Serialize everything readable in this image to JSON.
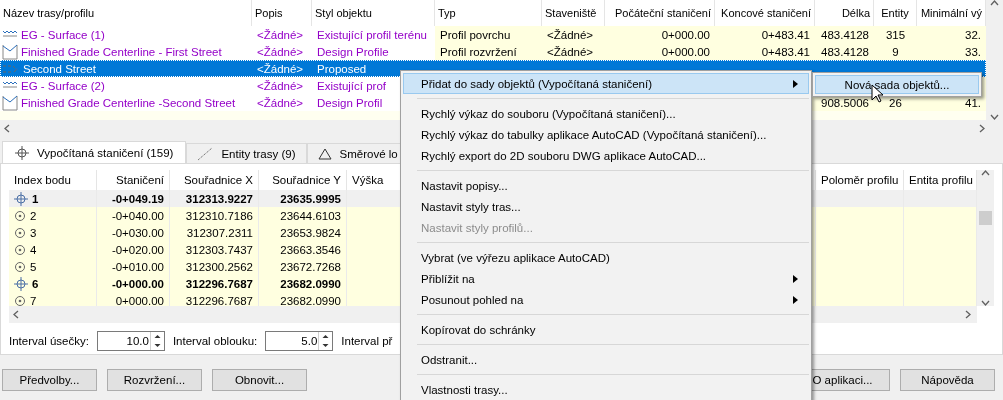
{
  "top_table": {
    "columns": [
      "Název trasy/profilu",
      "Popis",
      "Styl objektu",
      "Typ",
      "Staveniště",
      "Počáteční staničení",
      "Koncové staničení",
      "Délka",
      "Entity",
      "Minimální vý"
    ],
    "rows": [
      {
        "children": [
          {
            "kind": "surface-profile",
            "selected": false,
            "cells": [
              "EG - Surface (1)",
              "<Žádné>",
              "Existující profil terénu",
              "Profil povrchu",
              "<Žádné>",
              "0+000.00",
              "0+483.41",
              "483.4128",
              "315",
              "32."
            ]
          },
          {
            "kind": "design-profile",
            "selected": false,
            "cells": [
              "Finished Grade Centerline - First Street",
              "<Žádné>",
              "Design Profile",
              "Profil rozvržení",
              "<Žádné>",
              "0+000.00",
              "0+483.41",
              "483.4128",
              "9",
              "33."
            ]
          }
        ]
      },
      {
        "kind": "alignment",
        "selected": true,
        "cells": [
          "Second Street",
          "<Žádné>",
          "Proposed"
        ],
        "children": [
          {
            "kind": "surface-profile",
            "selected": false,
            "cells": [
              "EG - Surface (2)",
              "<Žádné>",
              "Existující prof"
            ]
          },
          {
            "kind": "design-profile",
            "selected": false,
            "cells": [
              "Finished Grade Centerline -Second Street",
              "<Žádné>",
              "Design Profil",
              null,
              null,
              null,
              null,
              "908.5006",
              "26",
              "41."
            ]
          }
        ]
      }
    ]
  },
  "tabs": [
    {
      "label": "Vypočítaná staničení (159)",
      "selected": true
    },
    {
      "label": "Entity trasy (9)",
      "selected": false
    },
    {
      "label": "Směrové lo",
      "selected": false
    }
  ],
  "points_table": {
    "columns": [
      "Index bodu",
      "Staničení",
      "Souřadnice X",
      "Souřadnice Y",
      "Výška",
      "Poloměr profilu",
      "Entita profilu"
    ],
    "rows": [
      {
        "kind": "pi",
        "selected": true,
        "cells": [
          "1",
          "-0+049.19",
          "312313.9227",
          "23635.9995"
        ]
      },
      {
        "kind": "point",
        "selected": false,
        "cells": [
          "2",
          "-0+040.00",
          "312310.7186",
          "23644.6103"
        ]
      },
      {
        "kind": "point",
        "selected": false,
        "cells": [
          "3",
          "-0+030.00",
          "312307.2311",
          "23653.9824"
        ]
      },
      {
        "kind": "point",
        "selected": false,
        "cells": [
          "4",
          "-0+020.00",
          "312303.7437",
          "23663.3546"
        ]
      },
      {
        "kind": "point",
        "selected": false,
        "cells": [
          "5",
          "-0+010.00",
          "312300.2562",
          "23672.7268"
        ]
      },
      {
        "kind": "pi",
        "selected": false,
        "cells": [
          "6",
          "-0+000.00",
          "312296.7687",
          "23682.0990"
        ]
      },
      {
        "kind": "point",
        "selected": false,
        "cells": [
          "7",
          "0+000.00",
          "312296.7687",
          "23682.0990"
        ]
      }
    ]
  },
  "intervals": [
    {
      "label": "Interval úsečky:",
      "value": "10.0"
    },
    {
      "label": "Interval oblouku:",
      "value": "5.0"
    },
    {
      "label": "Interval př"
    }
  ],
  "buttons_left": [
    "Předvolby...",
    "Rozvržení...",
    "Obnovit..."
  ],
  "buttons_right": [
    "O aplikaci...",
    "Nápověda"
  ],
  "context_menu": {
    "items": [
      {
        "kind": "item",
        "label": "Přidat do sady objektů (Vypočítaná staničení)",
        "submenu": true,
        "selected": true,
        "disabled": false
      },
      {
        "kind": "separator"
      },
      {
        "kind": "item",
        "label": "Rychlý výkaz do souboru (Vypočítaná staničení)...",
        "submenu": false,
        "selected": false,
        "disabled": false
      },
      {
        "kind": "item",
        "label": "Rychlý výkaz do tabulky aplikace AutoCAD (Vypočítaná staničení)...",
        "submenu": false,
        "selected": false,
        "disabled": false
      },
      {
        "kind": "item",
        "label": "Rychlý export do 2D souboru DWG aplikace AutoCAD...",
        "submenu": false,
        "selected": false,
        "disabled": false
      },
      {
        "kind": "separator"
      },
      {
        "kind": "item",
        "label": "Nastavit popisy...",
        "submenu": false,
        "selected": false,
        "disabled": false
      },
      {
        "kind": "item",
        "label": "Nastavit styly tras...",
        "submenu": false,
        "selected": false,
        "disabled": false
      },
      {
        "kind": "item",
        "label": "Nastavit styly profilů...",
        "submenu": false,
        "selected": false,
        "disabled": true
      },
      {
        "kind": "separator"
      },
      {
        "kind": "item",
        "label": "Vybrat (ve výřezu aplikace AutoCAD)",
        "submenu": false,
        "selected": false,
        "disabled": false
      },
      {
        "kind": "item",
        "label": "Přiblížit na",
        "submenu": true,
        "selected": false,
        "disabled": false
      },
      {
        "kind": "item",
        "label": "Posunout pohled na",
        "submenu": true,
        "selected": false,
        "disabled": false
      },
      {
        "kind": "separator"
      },
      {
        "kind": "item",
        "label": "Kopírovat do schránky",
        "submenu": false,
        "selected": false,
        "disabled": false
      },
      {
        "kind": "separator"
      },
      {
        "kind": "item",
        "label": "Odstranit...",
        "submenu": false,
        "selected": false,
        "disabled": false
      },
      {
        "kind": "separator"
      },
      {
        "kind": "item",
        "label": "Vlastnosti trasy...",
        "submenu": false,
        "selected": false,
        "disabled": false
      }
    ],
    "submenu": [
      {
        "label": "Nová sada objektů...",
        "selected": true
      }
    ]
  }
}
